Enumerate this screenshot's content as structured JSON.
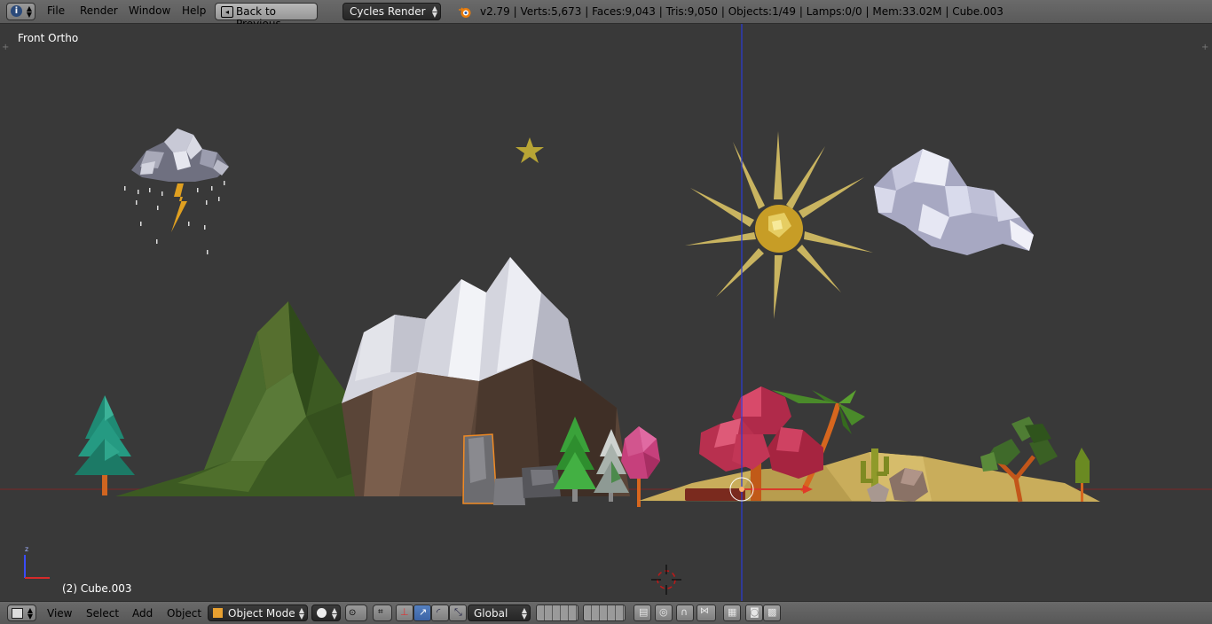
{
  "header": {
    "menus": [
      "File",
      "Render",
      "Window",
      "Help"
    ],
    "back_button": "Back to Previous",
    "render_engine": "Cycles Render",
    "stats": "v2.79 | Verts:5,673 | Faces:9,043 | Tris:9,050 | Objects:1/49 | Lamps:0/0 | Mem:33.02M | Cube.003",
    "info_icon": "info-icon",
    "blender_icon": "blender-logo-icon"
  },
  "viewport": {
    "view_name": "Front Ortho",
    "active_object": "(2) Cube.003",
    "axis_label": "z"
  },
  "footer": {
    "menus": [
      "View",
      "Select",
      "Add",
      "Object"
    ],
    "mode": "Object Mode",
    "orientation": "Global"
  },
  "colors": {
    "viewport_bg": "#393939",
    "header_bg": "#626262",
    "z_axis": "#2a3bd8",
    "x_axis": "#b02020",
    "selection": "#f08a24"
  }
}
